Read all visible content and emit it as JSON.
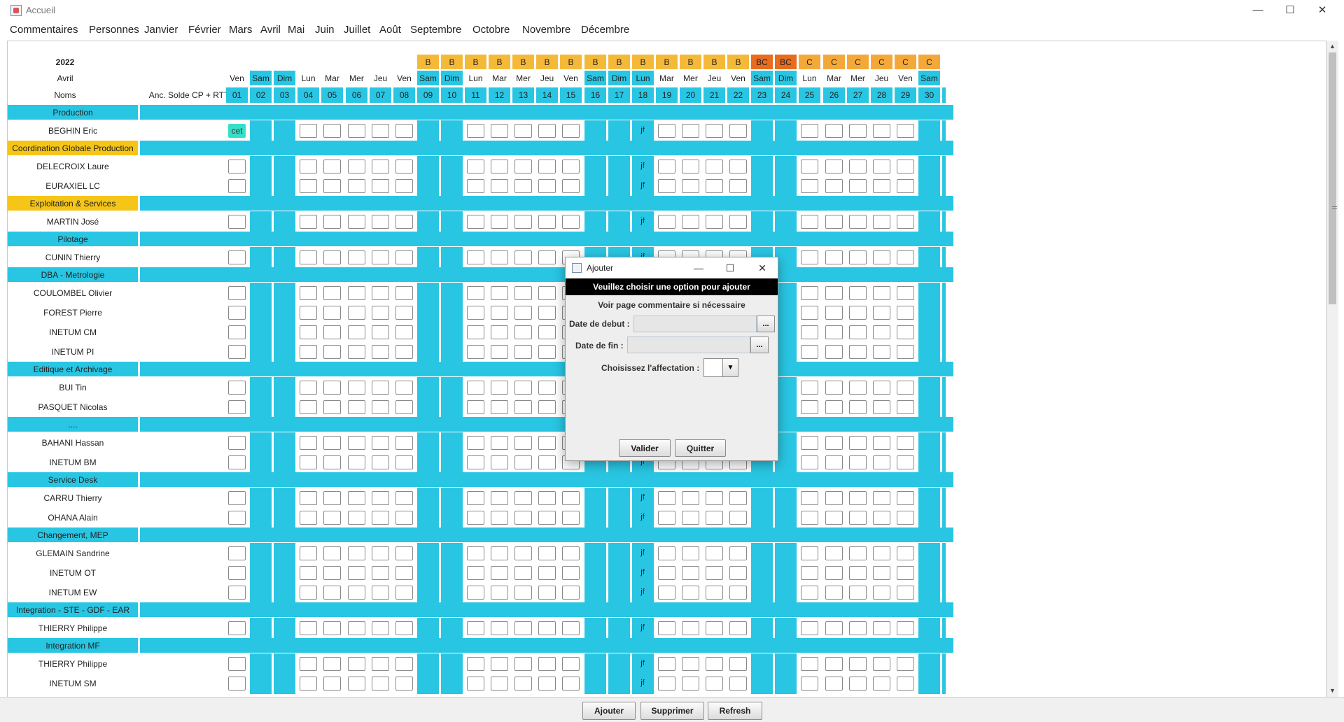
{
  "window": {
    "title": "Accueil",
    "minimize": "—",
    "maximize": "☐",
    "close": "✕"
  },
  "menu": [
    "Commentaires",
    "Personnes",
    "Janvier",
    "Février",
    "Mars",
    "Avril",
    "Mai",
    "Juin",
    "Juillet",
    "Août",
    "Septembre",
    "Octobre",
    "Novembre",
    "Décembre"
  ],
  "header": {
    "year": "2022",
    "month": "Avril",
    "names_label": "Noms",
    "balance_label": "Anc. Solde CP + RTT"
  },
  "colors": {
    "weekend": "#29c6e3",
    "period_b": "#f5b93a",
    "period_bc": "#e86b1e",
    "period_c": "#f5a83a",
    "group_yellow": "#f5c518",
    "cet": "#36e0c8"
  },
  "days": [
    {
      "n": "01",
      "d": "Ven",
      "p": "",
      "we": false
    },
    {
      "n": "02",
      "d": "Sam",
      "p": "",
      "we": true
    },
    {
      "n": "03",
      "d": "Dim",
      "p": "",
      "we": true
    },
    {
      "n": "04",
      "d": "Lun",
      "p": "",
      "we": false
    },
    {
      "n": "05",
      "d": "Mar",
      "p": "",
      "we": false
    },
    {
      "n": "06",
      "d": "Mer",
      "p": "",
      "we": false
    },
    {
      "n": "07",
      "d": "Jeu",
      "p": "",
      "we": false
    },
    {
      "n": "08",
      "d": "Ven",
      "p": "",
      "we": false
    },
    {
      "n": "09",
      "d": "Sam",
      "p": "B",
      "we": true
    },
    {
      "n": "10",
      "d": "Dim",
      "p": "B",
      "we": true
    },
    {
      "n": "11",
      "d": "Lun",
      "p": "B",
      "we": false
    },
    {
      "n": "12",
      "d": "Mar",
      "p": "B",
      "we": false
    },
    {
      "n": "13",
      "d": "Mer",
      "p": "B",
      "we": false
    },
    {
      "n": "14",
      "d": "Jeu",
      "p": "B",
      "we": false
    },
    {
      "n": "15",
      "d": "Ven",
      "p": "B",
      "we": false
    },
    {
      "n": "16",
      "d": "Sam",
      "p": "B",
      "we": true
    },
    {
      "n": "17",
      "d": "Dim",
      "p": "B",
      "we": true
    },
    {
      "n": "18",
      "d": "Lun",
      "p": "B",
      "we": true
    },
    {
      "n": "19",
      "d": "Mar",
      "p": "B",
      "we": false
    },
    {
      "n": "20",
      "d": "Mer",
      "p": "B",
      "we": false
    },
    {
      "n": "21",
      "d": "Jeu",
      "p": "B",
      "we": false
    },
    {
      "n": "22",
      "d": "Ven",
      "p": "B",
      "we": false
    },
    {
      "n": "23",
      "d": "Sam",
      "p": "BC",
      "we": true
    },
    {
      "n": "24",
      "d": "Dim",
      "p": "BC",
      "we": true
    },
    {
      "n": "25",
      "d": "Lun",
      "p": "C",
      "we": false
    },
    {
      "n": "26",
      "d": "Mar",
      "p": "C",
      "we": false
    },
    {
      "n": "27",
      "d": "Mer",
      "p": "C",
      "we": false
    },
    {
      "n": "28",
      "d": "Jeu",
      "p": "C",
      "we": false
    },
    {
      "n": "29",
      "d": "Ven",
      "p": "C",
      "we": false
    },
    {
      "n": "30",
      "d": "Sam",
      "p": "C",
      "we": true
    }
  ],
  "rows": [
    {
      "type": "group",
      "label": "Production",
      "yellow": false
    },
    {
      "type": "person",
      "name": "BEGHIN Eric",
      "first": "cet",
      "jf": true
    },
    {
      "type": "group",
      "label": "Coordination Globale Production",
      "yellow": true
    },
    {
      "type": "person",
      "name": "DELECROIX Laure",
      "first": "",
      "jf": true
    },
    {
      "type": "person",
      "name": "EURAXIEL LC",
      "first": "",
      "jf": true
    },
    {
      "type": "group",
      "label": "Exploitation & Services",
      "yellow": true
    },
    {
      "type": "person",
      "name": "MARTIN José",
      "first": "",
      "jf": true
    },
    {
      "type": "group",
      "label": "Pilotage",
      "yellow": false
    },
    {
      "type": "person",
      "name": "CUNIN Thierry",
      "first": "",
      "jf": true
    },
    {
      "type": "group",
      "label": "DBA - Metrologie",
      "yellow": false
    },
    {
      "type": "person",
      "name": "COULOMBEL Olivier",
      "first": "",
      "jf": true
    },
    {
      "type": "person",
      "name": "FOREST Pierre",
      "first": "",
      "jf": true
    },
    {
      "type": "person",
      "name": "INETUM CM",
      "first": "",
      "jf": true
    },
    {
      "type": "person",
      "name": "INETUM PI",
      "first": "",
      "jf": true
    },
    {
      "type": "group",
      "label": "Editique et Archivage",
      "yellow": false
    },
    {
      "type": "person",
      "name": "BUI Tin",
      "first": "",
      "jf": true
    },
    {
      "type": "person",
      "name": "PASQUET Nicolas",
      "first": "",
      "jf": true
    },
    {
      "type": "group",
      "label": "....",
      "yellow": false
    },
    {
      "type": "person",
      "name": "BAHANI Hassan",
      "first": "",
      "jf": true
    },
    {
      "type": "person",
      "name": "INETUM BM",
      "first": "",
      "jf": true
    },
    {
      "type": "group",
      "label": "Service Desk",
      "yellow": false
    },
    {
      "type": "person",
      "name": "CARRU Thierry",
      "first": "",
      "jf": true
    },
    {
      "type": "person",
      "name": "OHANA Alain",
      "first": "",
      "jf": true
    },
    {
      "type": "group",
      "label": "Changement, MEP",
      "yellow": false
    },
    {
      "type": "person",
      "name": "GLEMAIN Sandrine",
      "first": "",
      "jf": true
    },
    {
      "type": "person",
      "name": "INETUM OT",
      "first": "",
      "jf": true
    },
    {
      "type": "person",
      "name": "INETUM EW",
      "first": "",
      "jf": true
    },
    {
      "type": "group",
      "label": "Integration - STE - GDF - EAR",
      "yellow": false
    },
    {
      "type": "person",
      "name": "THIERRY Philippe",
      "first": "",
      "jf": true
    },
    {
      "type": "group",
      "label": "Integration MF",
      "yellow": false
    },
    {
      "type": "person",
      "name": "THIERRY Philippe",
      "first": "",
      "jf": true
    },
    {
      "type": "person",
      "name": "INETUM SM",
      "first": "",
      "jf": true
    }
  ],
  "jf_label": "jf",
  "buttons": {
    "add": "Ajouter",
    "delete": "Supprimer",
    "refresh": "Refresh"
  },
  "dialog": {
    "title": "Ajouter",
    "banner": "Veuillez choisir une option pour ajouter",
    "subtitle": "Voir page commentaire si nécessaire",
    "start_label": "Date de debut :",
    "end_label": "Date de fin :",
    "assign_label": "Choisissez l'affectation :",
    "dots": "...",
    "validate": "Valider",
    "quit": "Quitter",
    "start_value": "",
    "end_value": ""
  }
}
